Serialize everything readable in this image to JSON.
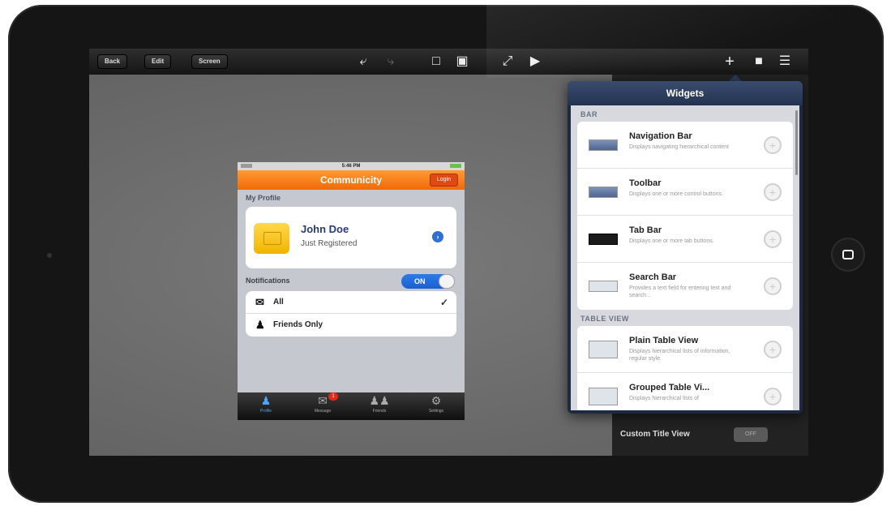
{
  "toolbar": {
    "back_label": "Back",
    "edit_label": "Edit",
    "screen_label": "Screen",
    "icons": [
      "undo-icon",
      "redo-icon",
      "frame-icon",
      "lock-icon",
      "expand-icon",
      "play-icon",
      "add-icon",
      "document-icon",
      "settings-icon"
    ]
  },
  "phone": {
    "status_time": "5:46 PM",
    "nav_title": "Communicity",
    "login_label": "Login",
    "section_profile": "My Profile",
    "profile_name": "John Doe",
    "profile_status": "Just Registered",
    "notifications_label": "Notifications",
    "toggle_label": "ON",
    "list": [
      {
        "label": "All",
        "checked": true
      },
      {
        "label": "Friends Only",
        "checked": false
      }
    ],
    "tabs": [
      {
        "label": "Profile",
        "icon": "person-icon"
      },
      {
        "label": "Message",
        "icon": "mail-icon",
        "badge": "1"
      },
      {
        "label": "Friends",
        "icon": "people-icon"
      },
      {
        "label": "Settings",
        "icon": "gear-icon"
      }
    ]
  },
  "popover": {
    "title": "Widgets",
    "sections": [
      {
        "header": "BAR",
        "items": [
          {
            "name": "Navigation Bar",
            "desc": "Displays navigating hierarchical content"
          },
          {
            "name": "Toolbar",
            "desc": "Displays one or more control buttons."
          },
          {
            "name": "Tab Bar",
            "desc": "Displays one or more tab buttons."
          },
          {
            "name": "Search Bar",
            "desc": "Provides a text field for entering text and search..."
          }
        ]
      },
      {
        "header": "TABLE VIEW",
        "items": [
          {
            "name": "Plain Table View",
            "desc": "Displays hierarchical lists of information, regular style."
          },
          {
            "name": "Grouped Table Vi...",
            "desc": "Displays hierarchical lists of"
          }
        ]
      }
    ]
  },
  "inspector": {
    "custom_title_view_label": "Custom Title View",
    "custom_title_view_value": "OFF"
  }
}
